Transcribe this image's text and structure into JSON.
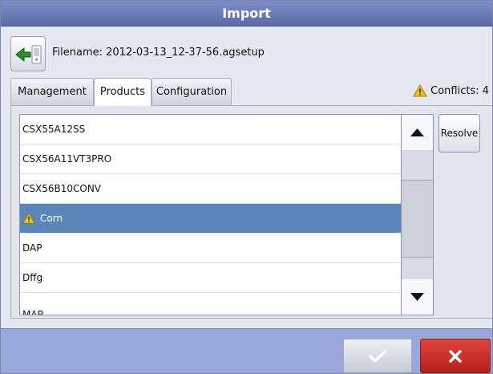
{
  "window": {
    "title": "Import"
  },
  "file": {
    "label": "Filename: 2012-03-13_12-37-56.agsetup"
  },
  "tabs": [
    {
      "label": "Management",
      "active": false
    },
    {
      "label": "Products",
      "active": true
    },
    {
      "label": "Configuration",
      "active": false
    }
  ],
  "conflicts": {
    "label": "Conflicts: 4",
    "icon": "warning-icon"
  },
  "products": {
    "items": [
      {
        "label": "CSX55A12SS",
        "selected": false
      },
      {
        "label": "CSX56A11VT3PRO",
        "selected": false
      },
      {
        "label": "CSX56B10CONV",
        "selected": false
      },
      {
        "label": "Corn",
        "selected": true,
        "warning": true
      },
      {
        "label": "DAP",
        "selected": false
      },
      {
        "label": "Dffg",
        "selected": false
      },
      {
        "label": "MAP",
        "selected": false
      }
    ]
  },
  "actions": {
    "resolve_label": "Resolve"
  },
  "colors": {
    "title_bar": "#6d7cb8",
    "selected_row": "#5b86b9",
    "cancel": "#c72a25",
    "warning": "#f2c21a"
  }
}
